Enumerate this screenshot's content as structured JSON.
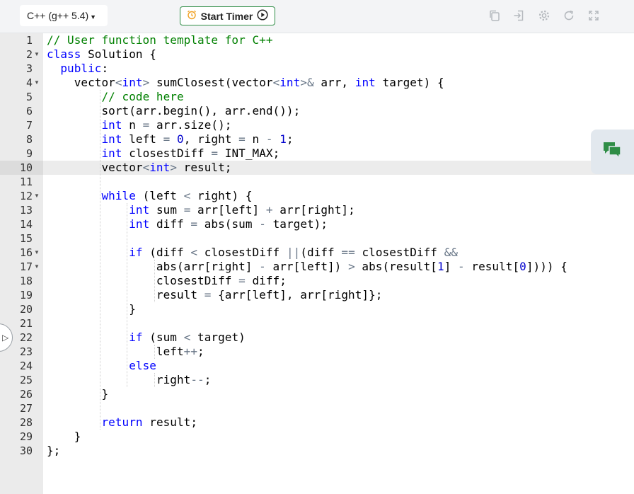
{
  "toolbar": {
    "language": "C++ (g++ 5.4)",
    "timer_label": "Start Timer",
    "icons": [
      "copy-icon",
      "sign-in-icon",
      "gear-icon",
      "reset-icon",
      "fullscreen-icon"
    ]
  },
  "editor": {
    "active_line": 10,
    "line_numbers": [
      "1",
      "2",
      "3",
      "4",
      "5",
      "6",
      "7",
      "8",
      "9",
      "10",
      "11",
      "12",
      "13",
      "14",
      "15",
      "16",
      "17",
      "18",
      "19",
      "20",
      "21",
      "22",
      "23",
      "24",
      "25",
      "26",
      "27",
      "28",
      "29",
      "30"
    ],
    "fold_lines": [
      2,
      4,
      12,
      16,
      17
    ],
    "lines": [
      "// User function template for C++",
      "class Solution {",
      "  public:",
      "    vector<int> sumClosest(vector<int>& arr, int target) {",
      "        // code here",
      "        sort(arr.begin(), arr.end());",
      "        int n = arr.size();",
      "        int left = 0, right = n - 1;",
      "        int closestDiff = INT_MAX;",
      "        vector<int> result;",
      "",
      "        while (left < right) {",
      "            int sum = arr[left] + arr[right];",
      "            int diff = abs(sum - target);",
      "",
      "            if (diff < closestDiff ||(diff == closestDiff &&",
      "                abs(arr[right] - arr[left]) > abs(result[1] - result[0]))) {",
      "                closestDiff = diff;",
      "                result = {arr[left], arr[right]};",
      "            }",
      "",
      "            if (sum < target)",
      "                left++;",
      "            else",
      "                right--;",
      "        }",
      "",
      "        return result;",
      "    }",
      "};"
    ]
  },
  "colors": {
    "keyword": "#0000ff",
    "comment": "#008000",
    "operator": "#687687",
    "number": "#0000cd",
    "accent_green": "#2f8d46"
  },
  "side_panel": {
    "chat_icon": "chat-icon",
    "toggle_icon": "play-arrow-icon"
  }
}
